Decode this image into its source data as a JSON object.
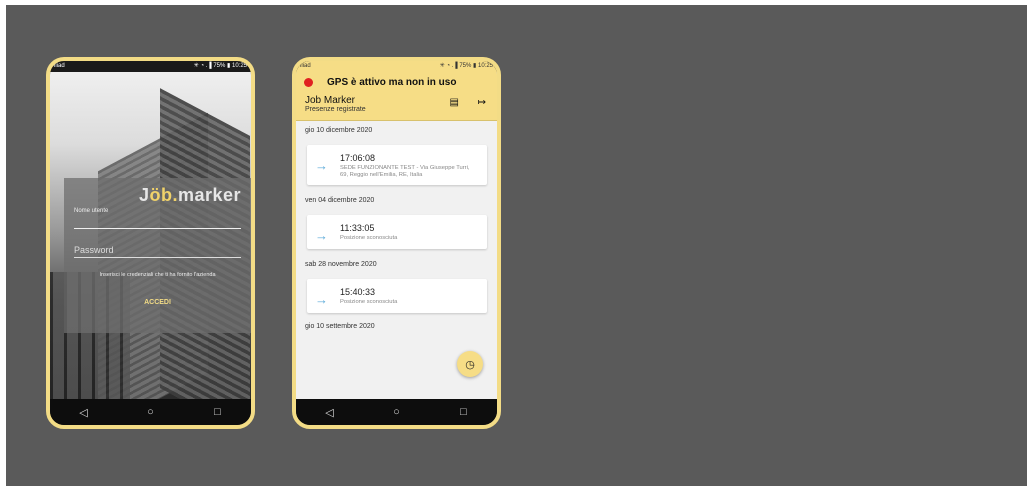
{
  "status_bar": {
    "carrier": "iliad",
    "signal_battery": "✳ ◔ .▐ 75% ▮ 10:25"
  },
  "login": {
    "logo_prefix": "J",
    "logo_accent": "öb.",
    "logo_suffix": "marker",
    "username_label": "Nome utente",
    "password_placeholder": "Password",
    "helper_text": "Inserisci le credenziali che ti ha fornito l'azienda",
    "login_button": "ACCEDI"
  },
  "app": {
    "gps_status": "GPS è attivo ma non in uso",
    "title": "Job Marker",
    "subtitle": "Presenze registrate",
    "list_icon": "list-icon",
    "exit_icon": "exit-icon",
    "groups": [
      {
        "date": "gio 10 dicembre 2020",
        "entries": [
          {
            "time": "17:06:08",
            "location": "SEDE FUNZIONANTE TEST - Via Giuseppe Turri, 69, Reggio nell'Emilia, RE, Italia"
          }
        ]
      },
      {
        "date": "ven 04 dicembre 2020",
        "entries": [
          {
            "time": "11:33:05",
            "location": "Posizione sconosciuta"
          }
        ]
      },
      {
        "date": "sab 28 novembre 2020",
        "entries": [
          {
            "time": "15:40:33",
            "location": "Posizione sconosciuta"
          }
        ]
      },
      {
        "date": "gio 10 settembre 2020",
        "entries": []
      }
    ],
    "fab_icon": "clock-icon"
  },
  "navigation": {
    "back": "◁",
    "home": "○",
    "recents": "□"
  },
  "colors": {
    "accent_yellow": "#f6dd86",
    "gps_dot": "#e02121",
    "arrow_blue": "#5aa9d8",
    "background": "#5a5a5a"
  }
}
